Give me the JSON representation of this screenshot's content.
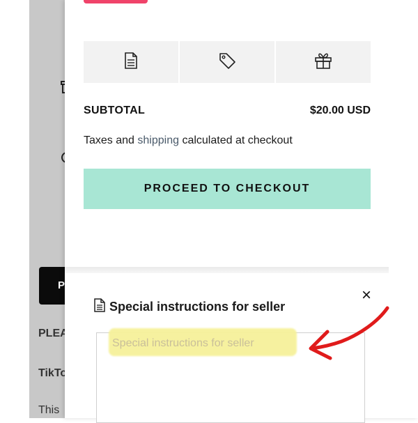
{
  "background": {
    "button_initial": "P",
    "text_line_1": "PLEA",
    "text_line_2": "TikTo",
    "text_line_3": "This"
  },
  "cart": {
    "tools": [
      {
        "icon": "note-icon"
      },
      {
        "icon": "tag-icon"
      },
      {
        "icon": "gift-icon"
      }
    ],
    "subtotal_label": "SUBTOTAL",
    "subtotal_value": "$20.00 USD",
    "tax_prefix": "Taxes and ",
    "tax_link": "shipping",
    "tax_suffix": " calculated at checkout",
    "checkout_label": "PROCEED TO CHECKOUT"
  },
  "notes_panel": {
    "title": "Special instructions for seller",
    "close_label": "×",
    "placeholder": "Special instructions for seller"
  },
  "colors": {
    "checkout_button": "#a8e6d4",
    "accent_pink": "#f0436a",
    "annotation_red": "#e01b1b",
    "highlight_yellow": "#f6f19a"
  }
}
